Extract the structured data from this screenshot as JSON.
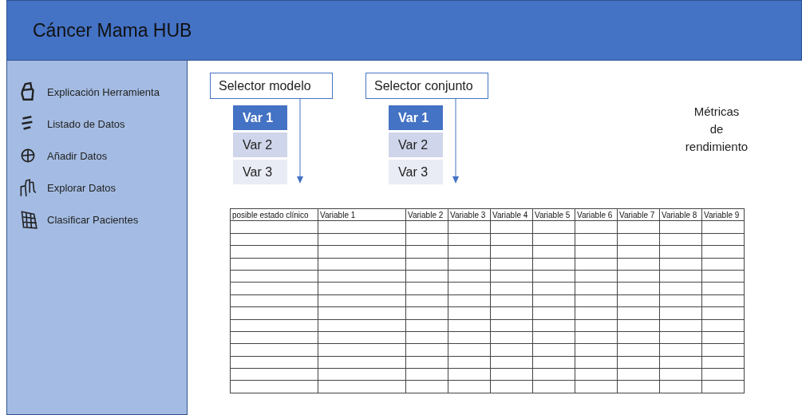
{
  "header": {
    "title": "Cáncer Mama HUB"
  },
  "sidebar": {
    "items": [
      {
        "label": "Explicación Herramienta",
        "kind": "house"
      },
      {
        "label": "Listado de Datos",
        "kind": "lines"
      },
      {
        "label": "Añadir Datos",
        "kind": "circle"
      },
      {
        "label": "Explorar Datos",
        "kind": "bars"
      },
      {
        "label": "Clasificar Pacientes",
        "kind": "grid"
      }
    ]
  },
  "selectors": [
    {
      "label": "Selector modelo",
      "options": [
        {
          "label": "Var 1",
          "selected": true
        },
        {
          "label": "Var 2",
          "selected": false
        },
        {
          "label": "Var 3",
          "selected": false
        }
      ]
    },
    {
      "label": "Selector conjunto",
      "options": [
        {
          "label": "Var 1",
          "selected": true
        },
        {
          "label": "Var 2",
          "selected": false
        },
        {
          "label": "Var 3",
          "selected": false
        }
      ]
    }
  ],
  "metrics": {
    "label": "Métricas\nde\nrendimiento"
  },
  "table": {
    "columns": [
      "posible estado clínico",
      "Variable 1",
      "Variable 2",
      "Variable 3",
      "Variable 4",
      "Variable 5",
      "Variable 6",
      "Variable 7",
      "Variable 8",
      "Variable 9"
    ]
  }
}
